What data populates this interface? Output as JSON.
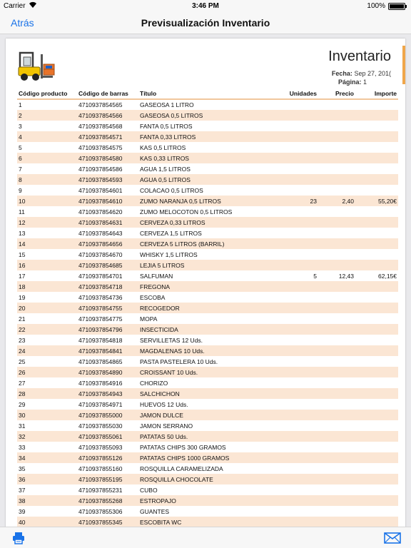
{
  "status": {
    "carrier": "Carrier",
    "time": "3:46 PM",
    "battery": "100%"
  },
  "nav": {
    "back": "Atrás",
    "title": "Previsualización Inventario"
  },
  "doc": {
    "title": "Inventario",
    "date_label": "Fecha:",
    "date_value": "Sep 27, 201(",
    "page_label": "Página:",
    "page_value": "1"
  },
  "table": {
    "headers": [
      "Código producto",
      "Código de barras",
      "Título",
      "Unidades",
      "Precio",
      "Importe"
    ],
    "rows": [
      [
        "1",
        "4710937854565",
        "GASEOSA 1 LITRO",
        "",
        "",
        ""
      ],
      [
        "2",
        "4710937854566",
        "GASEOSA 0,5 LITROS",
        "",
        "",
        ""
      ],
      [
        "3",
        "4710937854568",
        "FANTA 0,5 LITROS",
        "",
        "",
        ""
      ],
      [
        "4",
        "4710937854571",
        "FANTA 0,33 LITROS",
        "",
        "",
        ""
      ],
      [
        "5",
        "4710937854575",
        "KAS 0,5 LITROS",
        "",
        "",
        ""
      ],
      [
        "6",
        "4710937854580",
        "KAS 0,33 LITROS",
        "",
        "",
        ""
      ],
      [
        "7",
        "4710937854586",
        "AGUA 1,5 LITROS",
        "",
        "",
        ""
      ],
      [
        "8",
        "4710937854593",
        "AGUA 0,5 LITROS",
        "",
        "",
        ""
      ],
      [
        "9",
        "4710937854601",
        "COLACAO 0,5 LITROS",
        "",
        "",
        ""
      ],
      [
        "10",
        "4710937854610",
        "ZUMO NARANJA 0,5 LITROS",
        "23",
        "2,40",
        "55,20€"
      ],
      [
        "11",
        "4710937854620",
        "ZUMO MELOCOTON 0,5 LITROS",
        "",
        "",
        ""
      ],
      [
        "12",
        "4710937854631",
        "CERVEZA 0,33 LITROS",
        "",
        "",
        ""
      ],
      [
        "13",
        "4710937854643",
        "CERVEZA 1,5 LITROS",
        "",
        "",
        ""
      ],
      [
        "14",
        "4710937854656",
        "CERVEZA 5 LITROS (BARRIL)",
        "",
        "",
        ""
      ],
      [
        "15",
        "4710937854670",
        "WHISKY 1,5 LITROS",
        "",
        "",
        ""
      ],
      [
        "16",
        "4710937854685",
        "LEJIA 5 LITROS",
        "",
        "",
        ""
      ],
      [
        "17",
        "4710937854701",
        "SALFUMAN",
        "5",
        "12,43",
        "62,15€"
      ],
      [
        "18",
        "4710937854718",
        "FREGONA",
        "",
        "",
        ""
      ],
      [
        "19",
        "4710937854736",
        "ESCOBA",
        "",
        "",
        ""
      ],
      [
        "20",
        "4710937854755",
        "RECOGEDOR",
        "",
        "",
        ""
      ],
      [
        "21",
        "4710937854775",
        "MOPA",
        "",
        "",
        ""
      ],
      [
        "22",
        "4710937854796",
        "INSECTICIDA",
        "",
        "",
        ""
      ],
      [
        "23",
        "4710937854818",
        "SERVILLETAS 12 Uds.",
        "",
        "",
        ""
      ],
      [
        "24",
        "4710937854841",
        "MAGDALENAS 10 Uds.",
        "",
        "",
        ""
      ],
      [
        "25",
        "4710937854865",
        "PASTA PASTELERA 10 Uds.",
        "",
        "",
        ""
      ],
      [
        "26",
        "4710937854890",
        "CROISSANT 10 Uds.",
        "",
        "",
        ""
      ],
      [
        "27",
        "4710937854916",
        "CHORIZO",
        "",
        "",
        ""
      ],
      [
        "28",
        "4710937854943",
        "SALCHICHON",
        "",
        "",
        ""
      ],
      [
        "29",
        "4710937854971",
        "HUEVOS 12 Uds.",
        "",
        "",
        ""
      ],
      [
        "30",
        "4710937855000",
        "JAMON DULCE",
        "",
        "",
        ""
      ],
      [
        "31",
        "4710937855030",
        "JAMON SERRANO",
        "",
        "",
        ""
      ],
      [
        "32",
        "4710937855061",
        "PATATAS 50 Uds.",
        "",
        "",
        ""
      ],
      [
        "33",
        "4710937855093",
        "PATATAS CHIPS 300 GRAMOS",
        "",
        "",
        ""
      ],
      [
        "34",
        "4710937855126",
        "PATATAS CHIPS 1000 GRAMOS",
        "",
        "",
        ""
      ],
      [
        "35",
        "4710937855160",
        "ROSQUILLA CARAMELIZADA",
        "",
        "",
        ""
      ],
      [
        "36",
        "4710937855195",
        "ROSQUILLA CHOCOLATE",
        "",
        "",
        ""
      ],
      [
        "37",
        "4710937855231",
        "CUBO",
        "",
        "",
        ""
      ],
      [
        "38",
        "4710937855268",
        "ESTROPAJO",
        "",
        "",
        ""
      ],
      [
        "39",
        "4710937855306",
        "GUANTES",
        "",
        "",
        ""
      ],
      [
        "40",
        "4710937855345",
        "ESCOBITA WC",
        "",
        "",
        ""
      ]
    ]
  },
  "icons": {
    "logo": "forklift-logo-icon",
    "print": "printer-icon",
    "mail": "envelope-icon"
  },
  "colors": {
    "accent": "#1a73e8",
    "row_stripe": "#fbe6d4",
    "header_rule": "#f1c79c",
    "orange_bar": "#f0a64a"
  }
}
